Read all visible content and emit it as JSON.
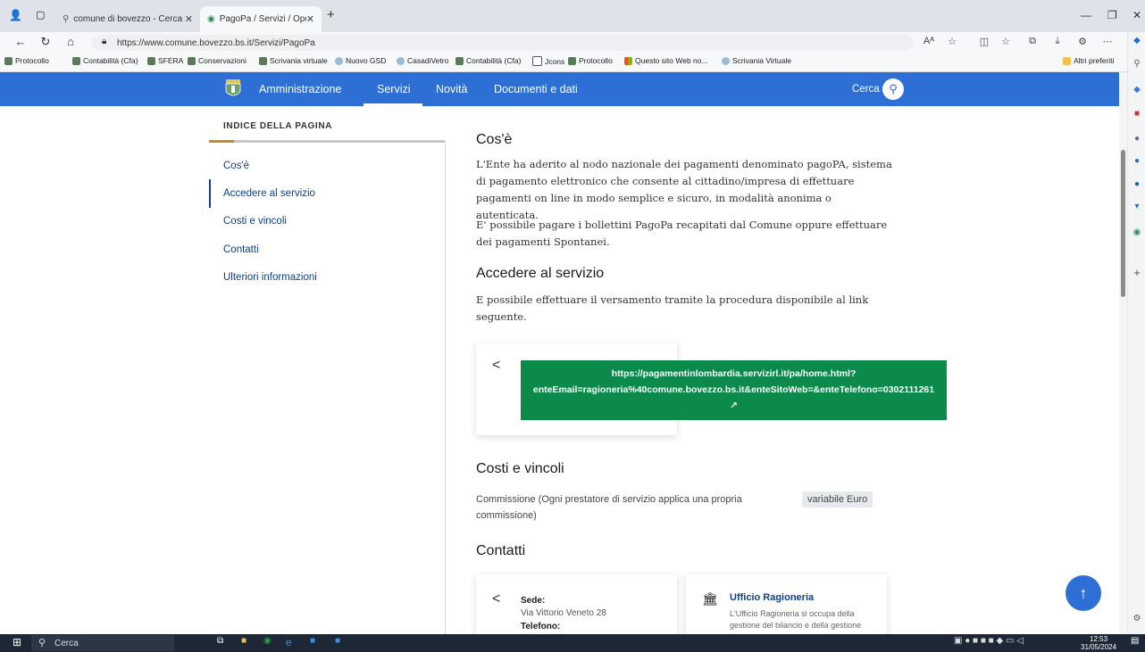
{
  "browser": {
    "tabs": [
      {
        "title": "comune di bovezzo - Cerca"
      },
      {
        "title": "PagoPa / Servizi / OpenCity - Co"
      }
    ],
    "new_tab": "+",
    "url": "https://www.comune.bovezzo.bs.it/Servizi/PagoPa",
    "reader_label": "Aᴬ",
    "favorites": [
      "Protocollo",
      "Contabilità (Cfa)",
      "SFERA",
      "Conservazioni",
      "Scrivania virtuale",
      "Nuovo GSD",
      "CasadiVetro",
      "Contabilità (Cfa)",
      "Jcons",
      "Protocollo",
      "Questo sito Web no...",
      "Scrivania Virtuale"
    ],
    "other_favorites": "Altri preferiti"
  },
  "site_nav": {
    "items": [
      "Amministrazione",
      "Servizi",
      "Novità",
      "Documenti e dati"
    ],
    "search_label": "Cerca"
  },
  "toc": {
    "title": "INDICE DELLA PAGINA",
    "items": [
      "Cos'è",
      "Accedere al servizio",
      "Costi e vincoli",
      "Contatti",
      "Ulteriori informazioni"
    ]
  },
  "content": {
    "cose_title": "Cos'è",
    "cose_p1": "L'Ente ha aderito al nodo nazionale dei pagamenti denominato pagoPA, sistema di pagamento elettronico che consente al cittadino/impresa di effettuare pagamenti on line in modo semplice e sicuro, in modalità anonima o autenticata.",
    "cose_p2": "E' possibile pagare i bollettini PagoPa recapitati dal Comune oppure effettuare dei pagamenti Spontanei.",
    "accedere_title": "Accedere al servizio",
    "accedere_p": "E possibile effettuare il versamento tramite la procedura disponibile al link seguente.",
    "link_line1": "https://pagamentinlombardia.servizirl.it/pa/home.html?",
    "link_line2": "enteEmail=ragioneria%40comune.bovezzo.bs.it&enteSitoWeb=&enteTelefono=0302111261",
    "link_icon": "↗",
    "costi_title": "Costi e vincoli",
    "costi_text": "Commissione (Ogni prestatore di servizio applica una propria commissione)",
    "costi_badge": "variabile Euro",
    "contatti_title": "Contatti",
    "contact1": {
      "label": "Sede:",
      "address": "Via Vittorio Veneto 28",
      "phone_label": "Telefono:"
    },
    "contact2": {
      "title": "Ufficio Ragioneria",
      "desc": "L'Ufficio Ragioneria si occupa della gestione del bilancio e della gestione"
    }
  },
  "taskbar": {
    "search": "Cerca",
    "time": "12:53",
    "date": "31/05/2024"
  },
  "colors": {
    "nav_blue": "#2e6fd6",
    "toc_link": "#0d3f8a",
    "green_button": "#0b8a4b",
    "toc_accent": "#cc8a1e"
  }
}
